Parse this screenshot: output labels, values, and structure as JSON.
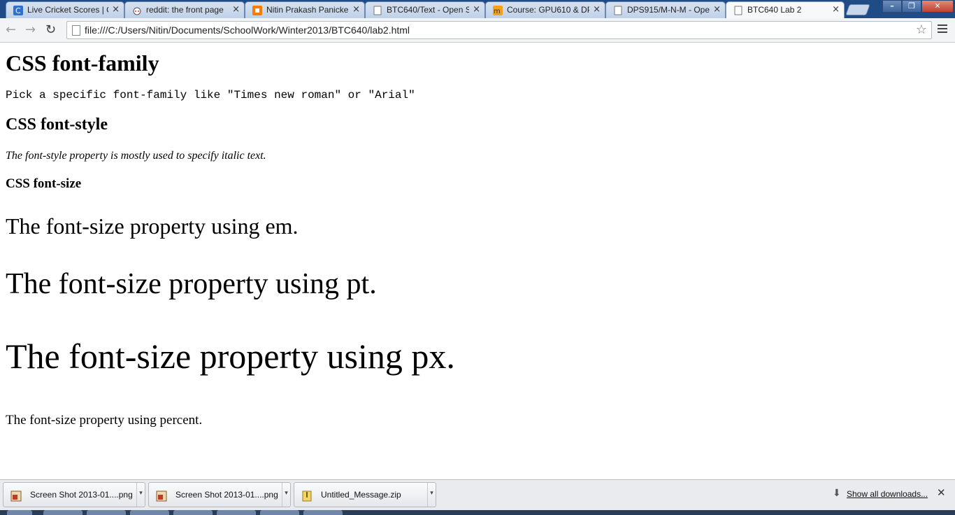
{
  "browser": {
    "tabs": [
      {
        "label": "Live Cricket Scores | C",
        "icon": "cricinfo-favicon"
      },
      {
        "label": "reddit: the front page",
        "icon": "reddit-favicon"
      },
      {
        "label": "Nitin Prakash Panicke",
        "icon": "blogger-favicon"
      },
      {
        "label": "BTC640/Text - Open S",
        "icon": "page-favicon"
      },
      {
        "label": "Course: GPU610 & DP",
        "icon": "moodle-favicon"
      },
      {
        "label": "DPS915/M-N-M - Ope",
        "icon": "page-favicon"
      },
      {
        "label": "BTC640 Lab 2",
        "icon": "page-favicon",
        "active": true
      }
    ],
    "tab_close_glyph": "×",
    "window_controls": {
      "minimize": "–",
      "maximize": "❐",
      "close": "✕"
    },
    "nav": {
      "back": "←",
      "forward": "→",
      "reload": "↻"
    },
    "url": "file:///C:/Users/Nitin/Documents/SchoolWork/Winter2013/BTC640/lab2.html",
    "bookmark_glyph": "☆"
  },
  "page": {
    "h1": "CSS font-family",
    "font_family_text": "Pick a specific font-family like \"Times new roman\" or \"Arial\"",
    "h2": "CSS font-style",
    "font_style_text": "The font-style property is mostly used to specify italic text.",
    "h3": "CSS font-size",
    "em_text": "The font-size property using em.",
    "pt_text": "The font-size property using pt.",
    "px_text": "The font-size property using px.",
    "percent_text": "The font-size property using percent."
  },
  "downloads": {
    "items": [
      {
        "name": "Screen Shot 2013-01....png",
        "icon": "image-file-icon"
      },
      {
        "name": "Screen Shot 2013-01....png",
        "icon": "image-file-icon"
      },
      {
        "name": "Untitled_Message.zip",
        "icon": "zip-file-icon"
      }
    ],
    "dropdown_glyph": "▾",
    "show_all": "Show all downloads...",
    "arrow_glyph": "⬇",
    "close_glyph": "✕"
  },
  "colors": {
    "tabstrip": "#1f4b87",
    "active_tab": "#f7f8fa",
    "link": "#111111"
  }
}
